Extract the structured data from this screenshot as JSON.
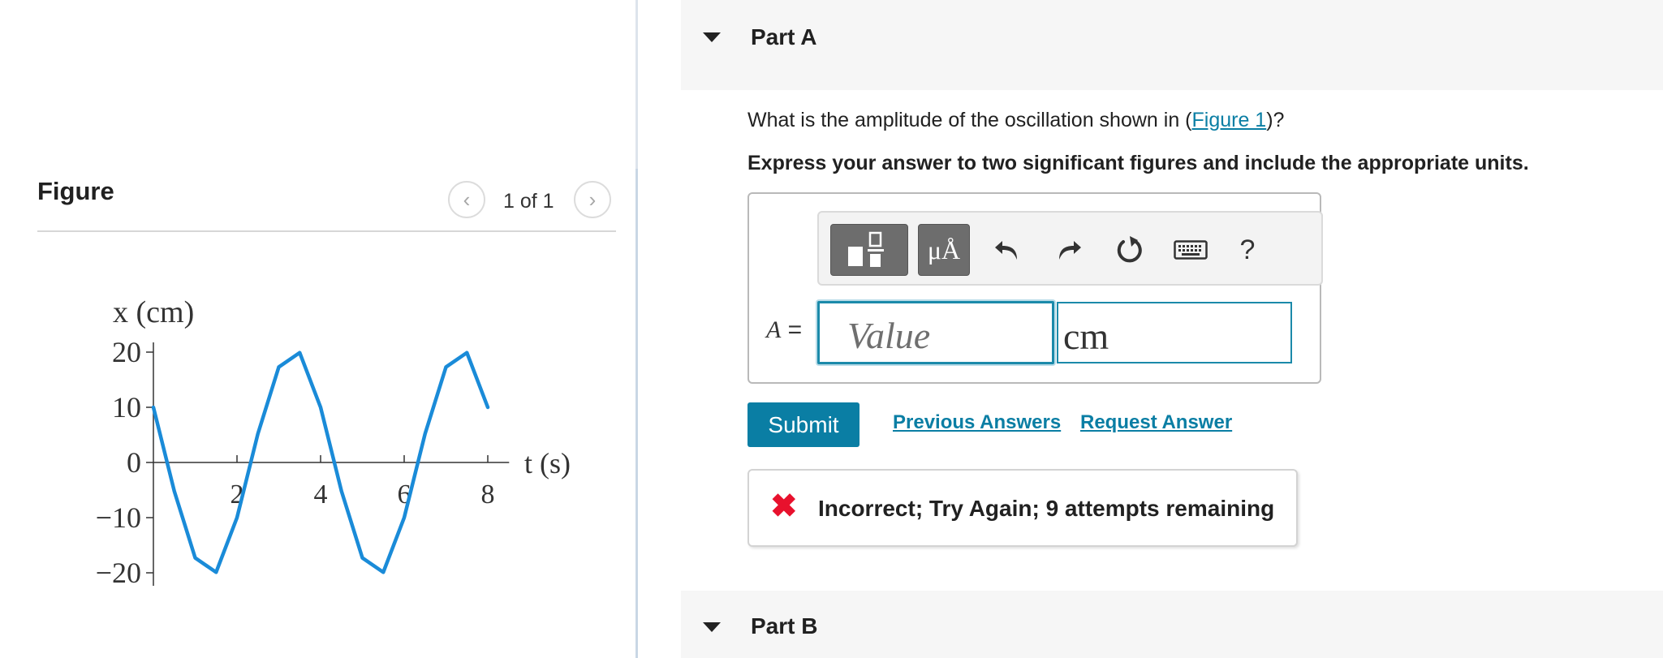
{
  "figure_panel": {
    "title": "Figure",
    "pager": "1 of 1",
    "prev_icon": "chevron-left-icon",
    "next_icon": "chevron-right-icon"
  },
  "chart_data": {
    "type": "line",
    "title": "",
    "xlabel": "t (s)",
    "ylabel": "x (cm)",
    "xlim": [
      0,
      8.2
    ],
    "ylim": [
      -20,
      20
    ],
    "x_ticks": [
      "2",
      "4",
      "6",
      "8"
    ],
    "y_ticks": [
      "20",
      "10",
      "0",
      "−10",
      "−20"
    ],
    "grid": false,
    "series": [
      {
        "color": "#1a8bd8",
        "x": [
          0,
          0.5,
          1.0,
          1.5,
          2.0,
          2.5,
          3.0,
          3.5,
          4.0,
          4.5,
          5.0,
          5.5,
          6.0,
          6.5,
          7.0,
          7.5,
          8.0
        ],
        "y": [
          10,
          -5.2,
          -17.3,
          -19.9,
          -10,
          5.2,
          17.3,
          19.9,
          10,
          -5.2,
          -17.3,
          -19.9,
          -10,
          5.2,
          17.3,
          19.9,
          10
        ]
      }
    ]
  },
  "part_a": {
    "title": "Part A",
    "question_before": "What is the amplitude of the oscillation shown in (",
    "figure_link": "Figure 1",
    "question_after": ")?",
    "instructions": "Express your answer to two significant figures and include the appropriate units.",
    "toolbar": {
      "templates_icon": "templates-icon",
      "units_label": "μÅ",
      "undo_icon": "undo-icon",
      "redo_icon": "redo-icon",
      "reset_icon": "reset-icon",
      "keyboard_icon": "keyboard-icon",
      "help_label": "?"
    },
    "variable_label": "A",
    "equals": "=",
    "value_placeholder": "Value",
    "unit_value": "cm",
    "submit_label": "Submit",
    "previous_answers_label": "Previous Answers",
    "request_answer_label": "Request Answer",
    "feedback": {
      "icon": "✖",
      "text": "Incorrect; Try Again; 9 attempts remaining",
      "color": "#e8112d"
    }
  },
  "part_b": {
    "title": "Part B"
  },
  "colors": {
    "accent": "#0a7ea4",
    "error": "#e8112d",
    "curve": "#1a8bd8"
  }
}
